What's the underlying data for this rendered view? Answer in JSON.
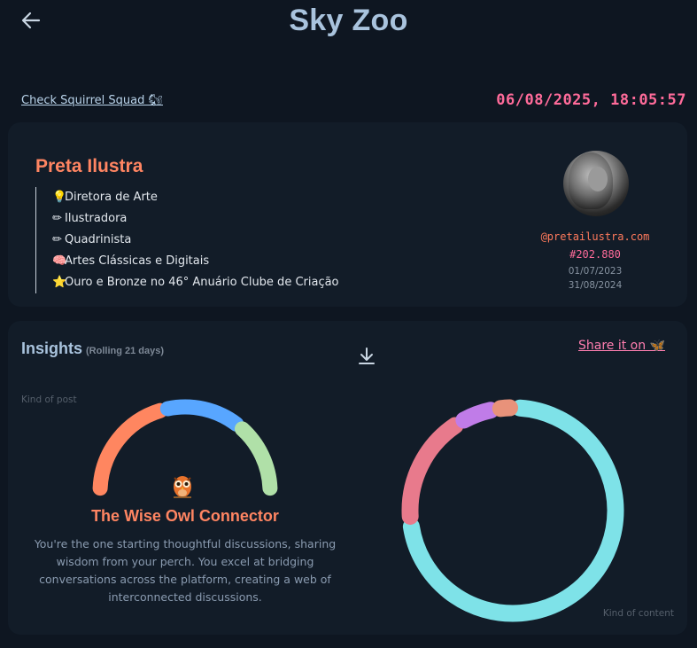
{
  "header": {
    "title": "Sky Zoo",
    "back_icon": "arrow-left-icon"
  },
  "top_bar": {
    "check_link": "Check Squirrel Squad 🐿",
    "timestamp": "06/08/2025, 18:05:57"
  },
  "profile": {
    "name": "Preta Ilustra",
    "bio": [
      {
        "emoji": "💡",
        "text": "Diretora de Arte"
      },
      {
        "emoji": "✏",
        "text": "Ilustradora"
      },
      {
        "emoji": "✏",
        "text": "Quadrinista"
      },
      {
        "emoji": "🧠",
        "text": "Artes Clássicas e Digitais"
      },
      {
        "emoji": "⭐",
        "text": "Ouro e Bronze no 46° Anuário Clube de Criação"
      }
    ],
    "handle": "@pretailustra.com",
    "member_number": "#202.880",
    "date_joined": "01/07/2023",
    "date_last": "31/08/2024"
  },
  "insights": {
    "title": "Insights",
    "subtitle": "(Rolling 21 days)",
    "download_icon": "download-icon",
    "share_label": "Share it on 🦋",
    "kind_of_post_label": "Kind of post",
    "kind_of_content_label": "Kind of content",
    "persona": {
      "icon": "owl-icon",
      "title": "The Wise Owl Connector",
      "description": "You're the one starting thoughtful discussions, sharing wisdom from your perch. You excel at bridging conversations across the platform, creating a web of interconnected discussions."
    },
    "post_gauge": {
      "segments": [
        {
          "value": 0.42,
          "color": "#ff8660"
        },
        {
          "value": 0.3,
          "color": "#58a6ff"
        },
        {
          "value": 0.28,
          "color": "#b0e0a8"
        }
      ]
    },
    "content_donut": {
      "segments": [
        {
          "value": 0.73,
          "color": "#7ee2e8"
        },
        {
          "value": 0.18,
          "color": "#e87a8c"
        },
        {
          "value": 0.06,
          "color": "#c07ce8"
        },
        {
          "value": 0.03,
          "color": "#e8927a"
        }
      ]
    }
  }
}
